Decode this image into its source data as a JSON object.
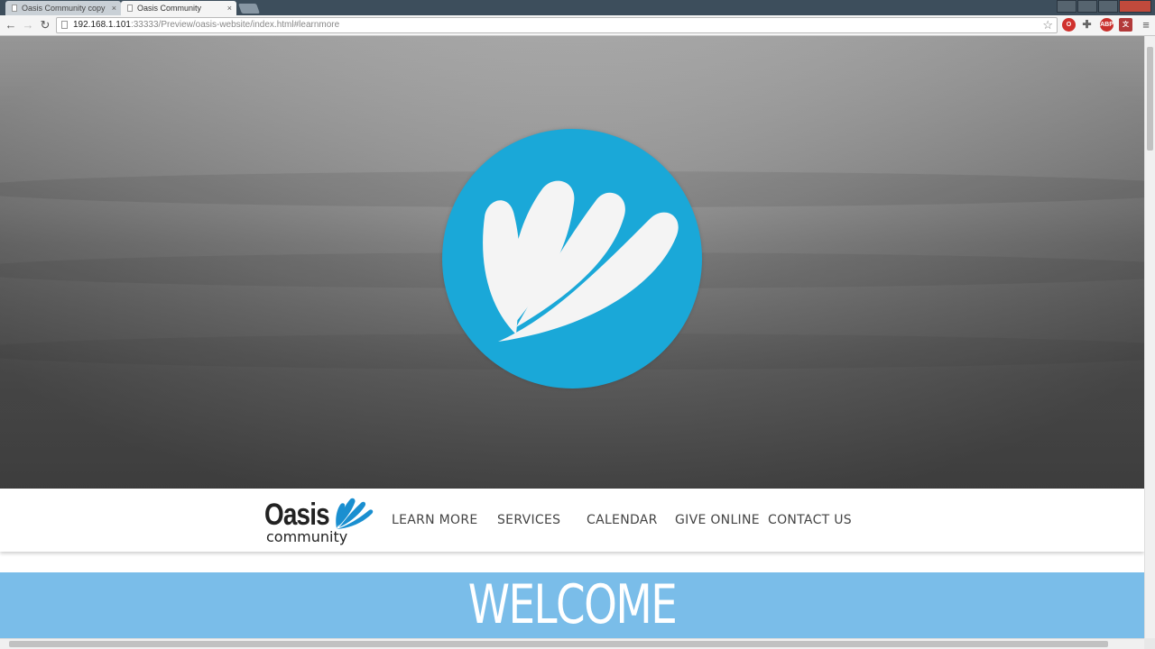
{
  "browser": {
    "tabs": [
      {
        "label": "Oasis Community copy",
        "close": "×"
      },
      {
        "label": "Oasis Community",
        "close": "×"
      }
    ],
    "url_host": "192.168.1.101",
    "url_rest": ":33333/Preview/oasis-website/index.html#learnmore",
    "nav": {
      "back": "←",
      "forward": "→",
      "reload": "↻"
    },
    "bookmark_icon": "☆",
    "extensions": [
      "opera-icon",
      "puzzle-icon",
      "abp-icon",
      "translate-icon"
    ],
    "abp_label": "ABP",
    "menu_icon": "≡"
  },
  "site": {
    "brand_word": "Oasis",
    "brand_sub": "community",
    "nav_items": [
      "LEARN MORE",
      "SERVICES",
      "CALENDAR",
      "GIVE ONLINE",
      "CONTACT US"
    ],
    "welcome": "WELCOME",
    "colors": {
      "logo_blue": "#1aa8d8",
      "welcome_band": "#7abde9",
      "brand_mark": "#1a8fd0"
    }
  }
}
